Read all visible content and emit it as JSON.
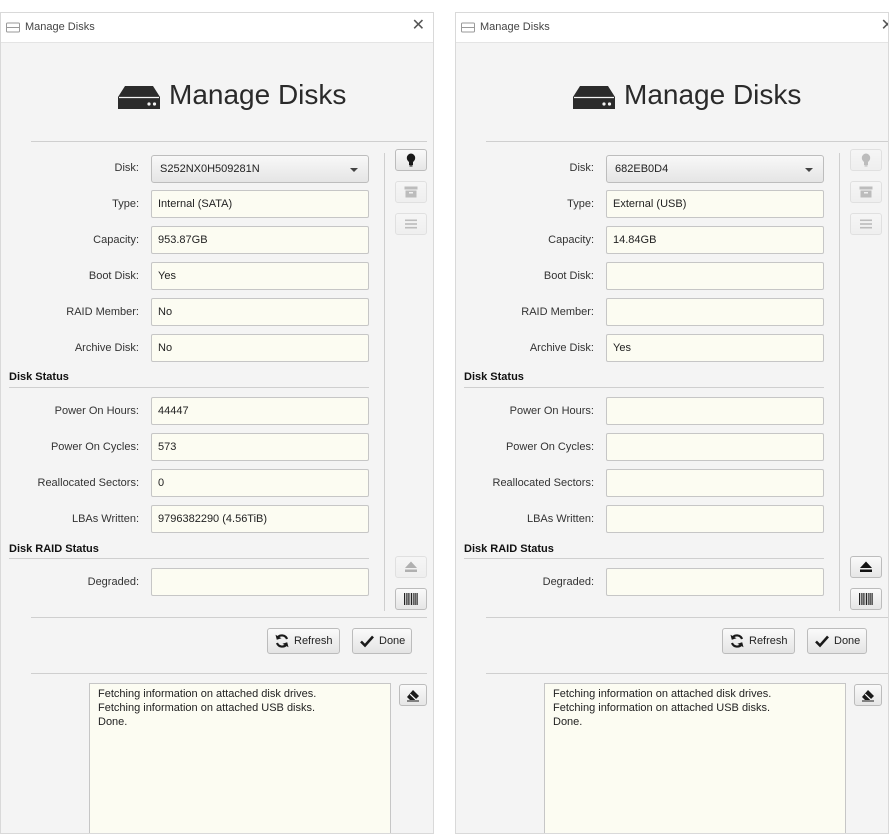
{
  "windows": [
    {
      "title": "Manage Disks",
      "heading": "Manage Disks",
      "disk_label": "Disk:",
      "disk_value": "S252NX0H509281N",
      "fields": [
        {
          "label": "Type:",
          "value": "Internal (SATA)"
        },
        {
          "label": "Capacity:",
          "value": "953.87GB"
        },
        {
          "label": "Boot Disk:",
          "value": "Yes"
        },
        {
          "label": "RAID Member:",
          "value": "No"
        },
        {
          "label": "Archive Disk:",
          "value": "No"
        }
      ],
      "status_section": "Disk Status",
      "status_fields": [
        {
          "label": "Power On Hours:",
          "value": "44447"
        },
        {
          "label": "Power On Cycles:",
          "value": "573"
        },
        {
          "label": "Reallocated Sectors:",
          "value": "0"
        },
        {
          "label": "LBAs Written:",
          "value": "9796382290 (4.56TiB)"
        }
      ],
      "raid_section": "Disk RAID Status",
      "raid_fields": [
        {
          "label": "Degraded:",
          "value": ""
        }
      ],
      "refresh_label": "Refresh",
      "done_label": "Done",
      "log_lines": [
        "Fetching information on attached disk drives.",
        "Fetching information on attached USB disks.",
        "Done."
      ],
      "side_buttons": {
        "identify_enabled": true,
        "eject_enabled": false
      }
    },
    {
      "title": "Manage Disks",
      "heading": "Manage Disks",
      "disk_label": "Disk:",
      "disk_value": "682EB0D4",
      "fields": [
        {
          "label": "Type:",
          "value": "External (USB)"
        },
        {
          "label": "Capacity:",
          "value": "14.84GB"
        },
        {
          "label": "Boot Disk:",
          "value": ""
        },
        {
          "label": "RAID Member:",
          "value": ""
        },
        {
          "label": "Archive Disk:",
          "value": "Yes"
        }
      ],
      "status_section": "Disk Status",
      "status_fields": [
        {
          "label": "Power On Hours:",
          "value": ""
        },
        {
          "label": "Power On Cycles:",
          "value": ""
        },
        {
          "label": "Reallocated Sectors:",
          "value": ""
        },
        {
          "label": "LBAs Written:",
          "value": ""
        }
      ],
      "raid_section": "Disk RAID Status",
      "raid_fields": [
        {
          "label": "Degraded:",
          "value": ""
        }
      ],
      "refresh_label": "Refresh",
      "done_label": "Done",
      "log_lines": [
        "Fetching information on attached disk drives.",
        "Fetching information on attached USB disks.",
        "Done."
      ],
      "side_buttons": {
        "identify_enabled": false,
        "eject_enabled": true
      }
    }
  ],
  "icons": {
    "window_icon": "disk-icon",
    "heading_icon": "hard-drive-icon",
    "identify": "lightbulb-icon",
    "archive": "archive-box-icon",
    "list": "list-icon",
    "eject": "eject-icon",
    "barcode": "barcode-icon",
    "refresh": "refresh-icon",
    "done": "checkmark-icon",
    "eraser": "eraser-icon"
  }
}
